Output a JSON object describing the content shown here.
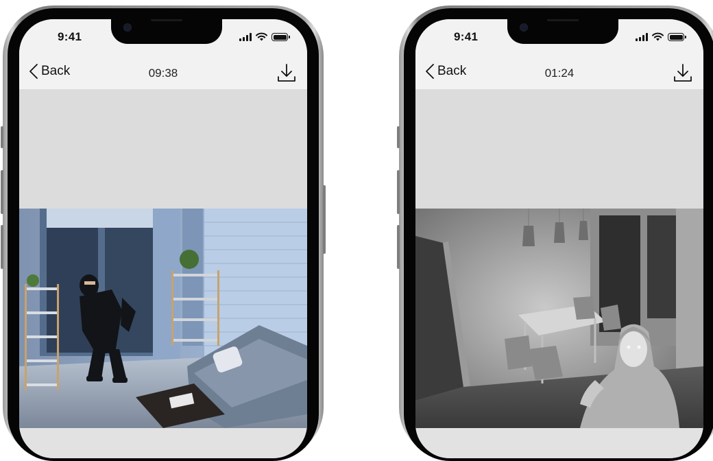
{
  "phones": [
    {
      "status_time": "9:41",
      "back_label": "Back",
      "nav_title": "09:38",
      "icons": [
        "chevron-left-icon",
        "download-icon",
        "signal-icon",
        "wifi-icon",
        "battery-icon"
      ],
      "video_mode": "color"
    },
    {
      "status_time": "9:41",
      "back_label": "Back",
      "nav_title": "01:24",
      "icons": [
        "chevron-left-icon",
        "download-icon",
        "signal-icon",
        "wifi-icon",
        "battery-icon"
      ],
      "video_mode": "night-vision"
    }
  ],
  "colors": {
    "header_bg": "#f2f2f2",
    "screen_bg": "#dcdcdc",
    "bezel": "#050505"
  }
}
